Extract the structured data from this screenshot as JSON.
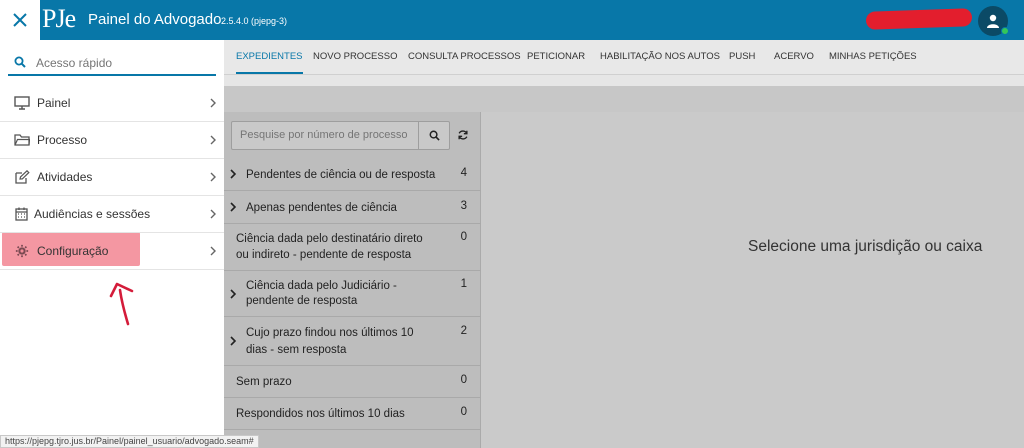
{
  "header": {
    "logo_text": "PJe",
    "title": "Painel do Advogado",
    "version": "2.5.4.0 (pjepg-3)",
    "accent": "#0877a8"
  },
  "nav": {
    "tabs": [
      {
        "label": "EXPEDIENTES",
        "active": true
      },
      {
        "label": "NOVO PROCESSO"
      },
      {
        "label": "CONSULTA PROCESSOS"
      },
      {
        "label": "PETICIONAR"
      },
      {
        "label": "HABILITAÇÃO NOS AUTOS"
      },
      {
        "label": "PUSH"
      },
      {
        "label": "ACERVO"
      },
      {
        "label": "MINHAS PETIÇÕES"
      }
    ]
  },
  "sidebar": {
    "quick_access_placeholder": "Acesso rápido",
    "items": [
      {
        "label": "Painel",
        "icon": "monitor-icon"
      },
      {
        "label": "Processo",
        "icon": "folder-icon"
      },
      {
        "label": "Atividades",
        "icon": "edit-icon"
      },
      {
        "label": "Audiências e sessões",
        "icon": "calendar-icon"
      },
      {
        "label": "Configuração",
        "icon": "gear-icon",
        "highlighted": true
      }
    ]
  },
  "list": {
    "search_placeholder": "Pesquise por número de processo",
    "rows": [
      {
        "line1": "Pendentes de ciência ou de resposta",
        "line2": "",
        "count": "4",
        "expandable": true
      },
      {
        "line1": "Apenas pendentes de ciência",
        "line2": "",
        "count": "3",
        "expandable": true
      },
      {
        "line1": "Ciência dada pelo destinatário direto",
        "line2": "ou indireto - pendente de resposta",
        "count": "0",
        "expandable": false
      },
      {
        "line1": "Ciência dada pelo Judiciário -",
        "line2": "pendente de resposta",
        "count": "1",
        "expandable": true
      },
      {
        "line1": "Cujo prazo findou nos últimos 10",
        "line2": "dias - sem resposta",
        "count": "2",
        "expandable": true
      },
      {
        "line1": "Sem prazo",
        "line2": "",
        "count": "0",
        "expandable": false
      },
      {
        "line1": "Respondidos nos últimos 10 dias",
        "line2": "",
        "count": "0",
        "expandable": false
      }
    ]
  },
  "main": {
    "empty_message": "Selecione uma jurisdição ou caixa"
  },
  "status_url": "https://pjepg.tjro.jus.br/Painel/painel_usuario/advogado.seam#"
}
